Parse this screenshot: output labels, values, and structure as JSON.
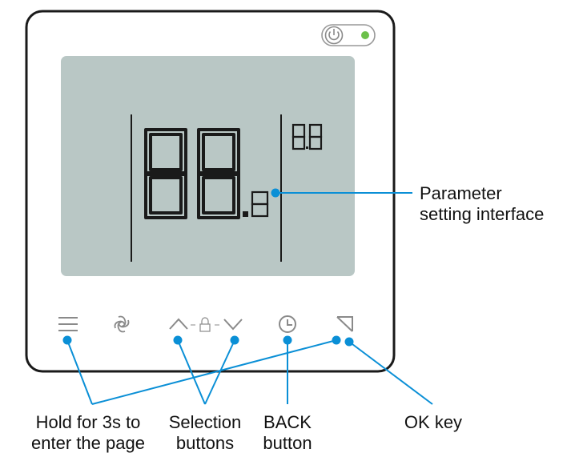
{
  "device": {
    "lcd": {
      "main_digits": "88",
      "decimal_digit": "8",
      "small_digits": "8.8"
    },
    "colors": {
      "frame": "#1a1a1a",
      "lcd_background": "#b9c7c5",
      "segment": "#1a1a1a",
      "icon": "#8a8a8a",
      "callout": "#0a8fd6",
      "power_indicator": "#6cc04a"
    },
    "icons": [
      "power-toggle-icon",
      "menu-icon",
      "fan-icon",
      "up-arrow-icon",
      "lock-icon",
      "down-arrow-icon",
      "clock-icon",
      "ok-arrow-icon"
    ]
  },
  "callouts": {
    "parameter": {
      "line1": "Parameter",
      "line2": "setting interface"
    },
    "menu": {
      "line1": "Hold for 3s to",
      "line2": "enter the page"
    },
    "selection": {
      "line1": "Selection",
      "line2": "buttons"
    },
    "back": {
      "line1": "BACK",
      "line2": "button"
    },
    "ok": {
      "line1": "OK key"
    }
  }
}
